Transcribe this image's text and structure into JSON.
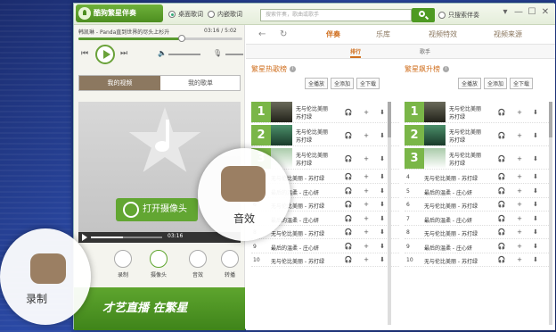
{
  "app": {
    "title": "酷狗繁星伴奏"
  },
  "titlebar": {
    "radio_desktop_lyrics": "桌面歌词",
    "radio_inner_lyrics": "内嵌歌词",
    "search_placeholder": "搜索伴奏，歌曲或歌手",
    "only_search_label": "只搜索伴奏",
    "window_controls": [
      "▾",
      "—",
      "☐",
      "✕"
    ]
  },
  "player": {
    "song_info": "韩凯琳 - Panda直到世界的尽头上杉升",
    "time": "03:16 / 5:02",
    "progress": 0.63
  },
  "left_tabs": {
    "my_video": "我的视频",
    "my_songlist": "我的歌单"
  },
  "video": {
    "open_camera": "打开摄像头",
    "time": "03:16",
    "progress": 0.45
  },
  "tools": [
    "录制",
    "摄像头",
    "音效",
    "转播"
  ],
  "banner": {
    "text": "才艺直播 在繁星"
  },
  "nav": {
    "tabs": [
      "伴奏",
      "乐库",
      "视频特效",
      "视频来源"
    ],
    "active": "伴奏"
  },
  "subnav": {
    "tabs": [
      "排行",
      "歌手"
    ]
  },
  "hot_list": {
    "title": "繁星热歌榜",
    "buttons": [
      "全播放",
      "全添加",
      "全下载"
    ],
    "top": [
      {
        "rank": "1",
        "song": "无与伦比美丽",
        "artist": "苏打绿"
      },
      {
        "rank": "2",
        "song": "无与伦比美丽",
        "artist": "苏打绿"
      },
      {
        "rank": "3",
        "song": "无与伦比美丽",
        "artist": "苏打绿"
      }
    ],
    "rows": [
      {
        "rank": "4",
        "text": "无与伦比美丽 - 苏打绿"
      },
      {
        "rank": "5",
        "text": "最后的温柔 - 庄心妍"
      },
      {
        "rank": "6",
        "text": "无与伦比美丽 - 苏打绿"
      },
      {
        "rank": "7",
        "text": "最后的温柔 - 庄心妍"
      },
      {
        "rank": "8",
        "text": "无与伦比美丽 - 苏打绿"
      },
      {
        "rank": "9",
        "text": "最后的温柔 - 庄心妍"
      },
      {
        "rank": "10",
        "text": "无与伦比美丽 - 苏打绿"
      }
    ]
  },
  "rise_list": {
    "title": "繁星飙升榜",
    "buttons": [
      "全播放",
      "全添加",
      "全下载"
    ],
    "top": [
      {
        "rank": "1",
        "song": "无与伦比美丽",
        "artist": "苏打绿"
      },
      {
        "rank": "2",
        "song": "无与伦比美丽",
        "artist": "苏打绿"
      },
      {
        "rank": "3",
        "song": "无与伦比美丽",
        "artist": "苏打绿"
      }
    ],
    "rows": [
      {
        "rank": "4",
        "text": "无与伦比美丽 - 苏打绿"
      },
      {
        "rank": "5",
        "text": "最后的温柔 - 庄心妍"
      },
      {
        "rank": "6",
        "text": "无与伦比美丽 - 苏打绿"
      },
      {
        "rank": "7",
        "text": "最后的温柔 - 庄心妍"
      },
      {
        "rank": "8",
        "text": "无与伦比美丽 - 苏打绿"
      },
      {
        "rank": "9",
        "text": "最后的温柔 - 庄心妍"
      },
      {
        "rank": "10",
        "text": "无与伦比美丽 - 苏打绿"
      }
    ]
  },
  "row_icons": [
    "headphones-icon",
    "plus-icon",
    "download-icon"
  ],
  "callouts": {
    "effects": "音效",
    "record": "录制"
  },
  "colors": {
    "accent_green": "#5ea52e",
    "accent_orange": "#d07020",
    "brown": "#8c7860"
  }
}
